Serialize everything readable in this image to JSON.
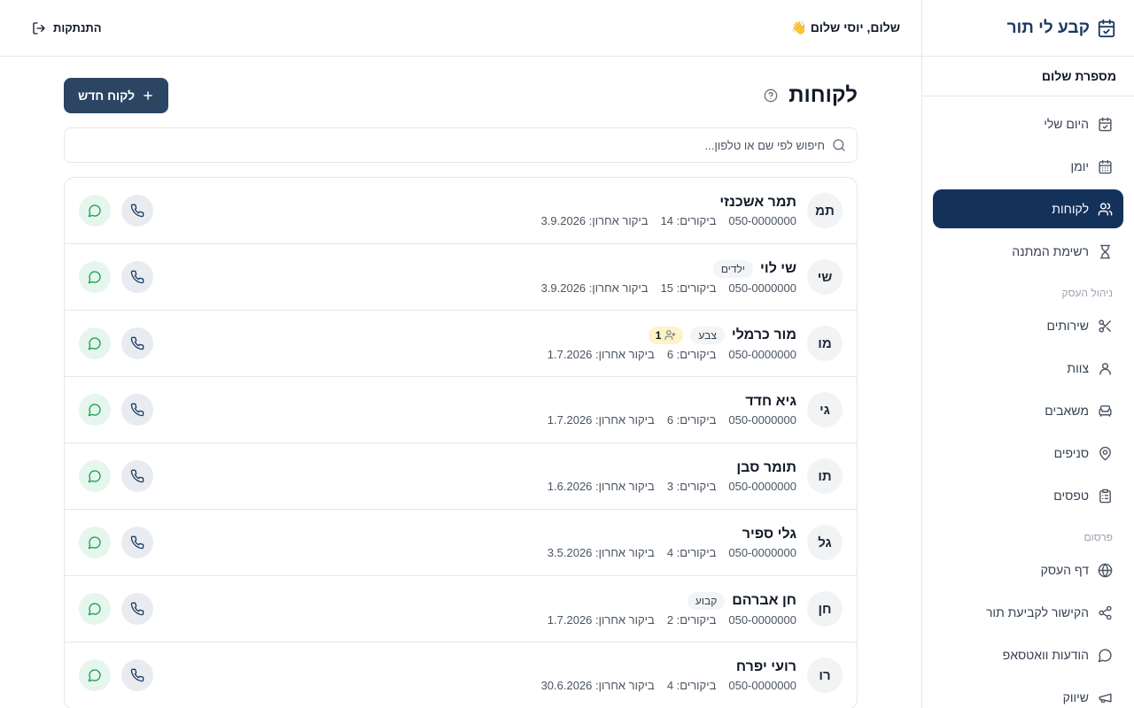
{
  "app": {
    "brand": "קבע לי תור",
    "business_name": "מספרת שלום"
  },
  "header": {
    "greeting": "שלום, יוסי שלום 👋",
    "logout_label": "התנתקות"
  },
  "sidebar": {
    "items": [
      {
        "label": "היום שלי",
        "icon": "calendar-check-icon"
      },
      {
        "label": "יומן",
        "icon": "calendar-icon"
      },
      {
        "label": "לקוחות",
        "icon": "users-icon",
        "active": true
      },
      {
        "label": "רשימת המתנה",
        "icon": "hourglass-icon"
      }
    ],
    "section_business": "ניהול העסק",
    "business_items": [
      {
        "label": "שירותים",
        "icon": "scissors-icon"
      },
      {
        "label": "צוות",
        "icon": "user-icon"
      },
      {
        "label": "משאבים",
        "icon": "armchair-icon"
      },
      {
        "label": "סניפים",
        "icon": "map-pin-icon"
      },
      {
        "label": "טפסים",
        "icon": "clipboard-icon"
      }
    ],
    "section_publish": "פרסום",
    "publish_items": [
      {
        "label": "דף העסק",
        "icon": "globe-icon"
      },
      {
        "label": "הקישור לקביעת תור",
        "icon": "share-icon"
      },
      {
        "label": "הודעות וואטסאפ",
        "icon": "message-icon"
      },
      {
        "label": "שיווק",
        "icon": "megaphone-icon"
      }
    ]
  },
  "main": {
    "title": "לקוחות",
    "new_button": "לקוח חדש",
    "search_placeholder": "חיפוש לפי שם או טלפון...",
    "customers": [
      {
        "initials": "תמ",
        "name": "תמר אשכנזי",
        "tags": [],
        "phone": "050-0000000",
        "visits": "ביקורים: 14",
        "last_visit": "ביקור אחרון: 3.9.2026"
      },
      {
        "initials": "שי",
        "name": "שי לוי",
        "tags": [
          "ילדים"
        ],
        "phone": "050-0000000",
        "visits": "ביקורים: 15",
        "last_visit": "ביקור אחרון: 3.9.2026"
      },
      {
        "initials": "מו",
        "name": "מור כרמלי",
        "tags": [
          "צבע"
        ],
        "family_badge": "1",
        "phone": "050-0000000",
        "visits": "ביקורים: 6",
        "last_visit": "ביקור אחרון: 1.7.2026"
      },
      {
        "initials": "גי",
        "name": "גיא חדד",
        "tags": [],
        "phone": "050-0000000",
        "visits": "ביקורים: 6",
        "last_visit": "ביקור אחרון: 1.7.2026"
      },
      {
        "initials": "תו",
        "name": "תומר סבן",
        "tags": [],
        "phone": "050-0000000",
        "visits": "ביקורים: 3",
        "last_visit": "ביקור אחרון: 1.6.2026"
      },
      {
        "initials": "גל",
        "name": "גלי ספיר",
        "tags": [],
        "phone": "050-0000000",
        "visits": "ביקורים: 4",
        "last_visit": "ביקור אחרון: 3.5.2026"
      },
      {
        "initials": "חן",
        "name": "חן אברהם",
        "tags": [
          "קבוע"
        ],
        "phone": "050-0000000",
        "visits": "ביקורים: 2",
        "last_visit": "ביקור אחרון: 1.7.2026"
      },
      {
        "initials": "רו",
        "name": "רועי יפרח",
        "tags": [],
        "phone": "050-0000000",
        "visits": "ביקורים: 4",
        "last_visit": "ביקור אחרון: 30.6.2026"
      }
    ]
  },
  "colors": {
    "primary": "#14315a",
    "button": "#2b4563",
    "whatsapp": "#16a34a",
    "badge_yellow": "#fdf3c7"
  }
}
